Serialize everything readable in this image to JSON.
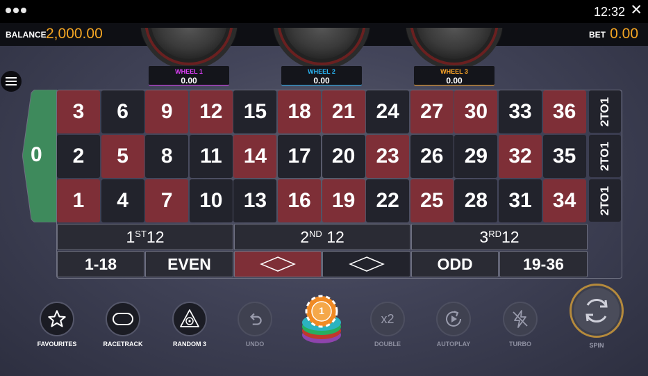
{
  "system": {
    "time": "12:32",
    "close": "✕"
  },
  "header": {
    "balance_label": "BALANCE",
    "balance_value": "2,000.00",
    "bet_label": "BET",
    "bet_value": "0.00"
  },
  "wheels": [
    {
      "name": "WHEEL 1",
      "value": "0.00",
      "color": "#e040fb"
    },
    {
      "name": "WHEEL 2",
      "value": "0.00",
      "color": "#29b6f6"
    },
    {
      "name": "WHEEL 3",
      "value": "0.00",
      "color": "#ffa726"
    }
  ],
  "table": {
    "zero": "0",
    "zero_color": "#3e8a5c",
    "rows": [
      [
        {
          "n": "3",
          "c": "red"
        },
        {
          "n": "6",
          "c": "black"
        },
        {
          "n": "9",
          "c": "red"
        },
        {
          "n": "12",
          "c": "red"
        },
        {
          "n": "15",
          "c": "black"
        },
        {
          "n": "18",
          "c": "red"
        },
        {
          "n": "21",
          "c": "red"
        },
        {
          "n": "24",
          "c": "black"
        },
        {
          "n": "27",
          "c": "red"
        },
        {
          "n": "30",
          "c": "red"
        },
        {
          "n": "33",
          "c": "black"
        },
        {
          "n": "36",
          "c": "red"
        }
      ],
      [
        {
          "n": "2",
          "c": "black"
        },
        {
          "n": "5",
          "c": "red"
        },
        {
          "n": "8",
          "c": "black"
        },
        {
          "n": "11",
          "c": "black"
        },
        {
          "n": "14",
          "c": "red"
        },
        {
          "n": "17",
          "c": "black"
        },
        {
          "n": "20",
          "c": "black"
        },
        {
          "n": "23",
          "c": "red"
        },
        {
          "n": "26",
          "c": "black"
        },
        {
          "n": "29",
          "c": "black"
        },
        {
          "n": "32",
          "c": "red"
        },
        {
          "n": "35",
          "c": "black"
        }
      ],
      [
        {
          "n": "1",
          "c": "red"
        },
        {
          "n": "4",
          "c": "black"
        },
        {
          "n": "7",
          "c": "red"
        },
        {
          "n": "10",
          "c": "black"
        },
        {
          "n": "13",
          "c": "black"
        },
        {
          "n": "16",
          "c": "red"
        },
        {
          "n": "19",
          "c": "red"
        },
        {
          "n": "22",
          "c": "black"
        },
        {
          "n": "25",
          "c": "red"
        },
        {
          "n": "28",
          "c": "black"
        },
        {
          "n": "31",
          "c": "black"
        },
        {
          "n": "34",
          "c": "red"
        }
      ]
    ],
    "column_bets": [
      "2TO1",
      "2TO1",
      "2TO1"
    ],
    "dozens": [
      {
        "num": "1",
        "sup": "ST",
        "rest": "12"
      },
      {
        "num": "2",
        "sup": "ND",
        "rest": "12"
      },
      {
        "num": "3",
        "sup": "RD",
        "rest": "12"
      }
    ],
    "outside": {
      "low": "1-18",
      "even": "EVEN",
      "odd": "ODD",
      "high": "19-36"
    }
  },
  "controls": {
    "favourites": "FAVOURITES",
    "racetrack": "RACETRACK",
    "random": "RANDOM 3",
    "undo": "UNDO",
    "chip_value": "1",
    "double": "DOUBLE",
    "double_icon": "x2",
    "autoplay": "AUTOPLAY",
    "turbo": "TURBO",
    "spin": "SPIN"
  }
}
